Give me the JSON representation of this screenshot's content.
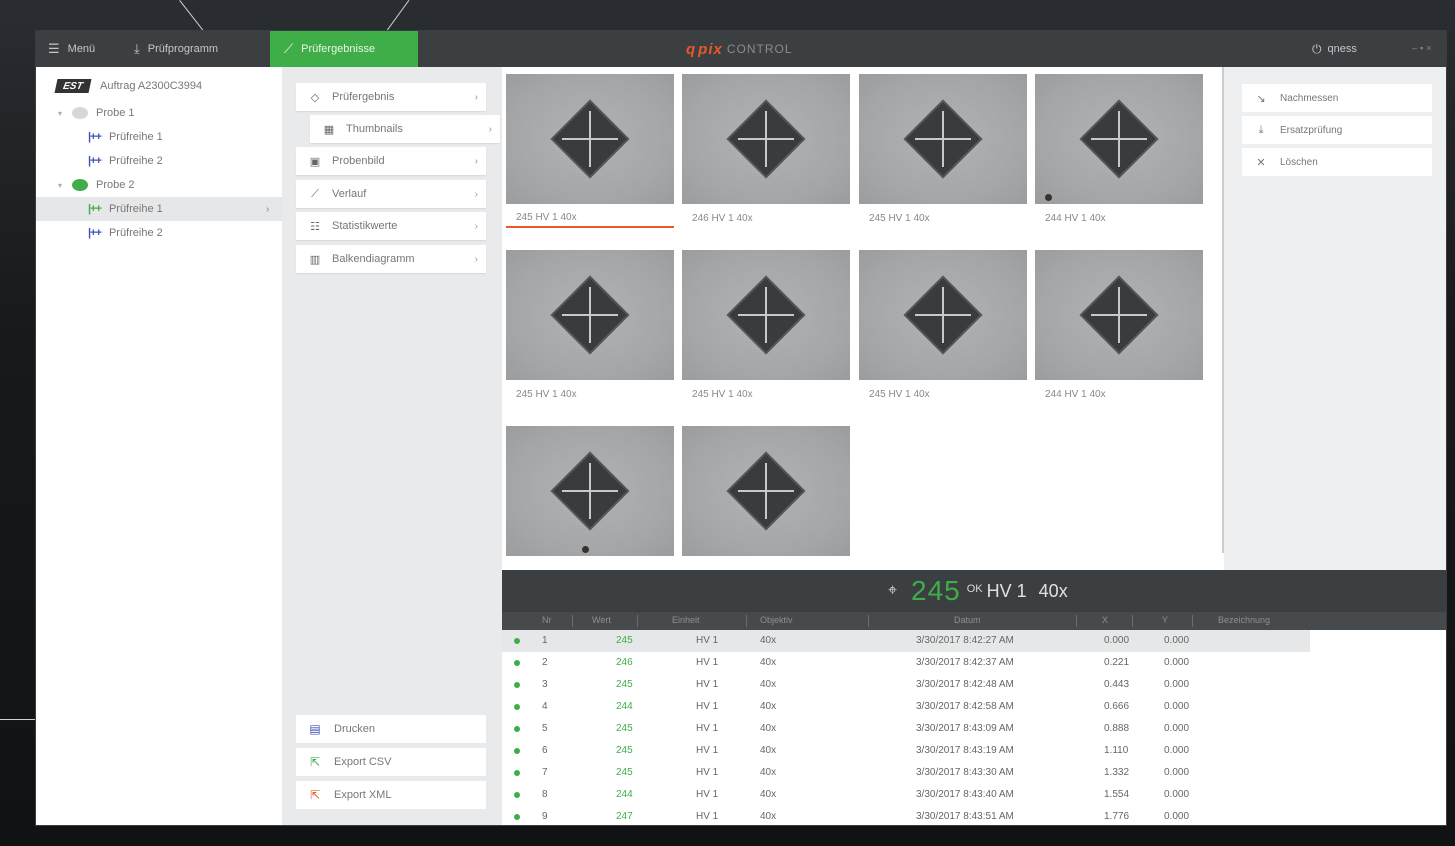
{
  "topbar": {
    "menu_label": "Menü",
    "pruefprogramm_label": "Prüfprogramm",
    "active_tab_label": "Prüfergebnisse",
    "brand_q": "q",
    "brand_pix": "pix",
    "brand_control": "CONTROL",
    "user_label": "qness"
  },
  "tree": {
    "order_label": "Auftrag A2300C3994",
    "items": [
      {
        "label": "Probe 1",
        "level": 0
      },
      {
        "label": "Prüfreihe 1",
        "level": 1
      },
      {
        "label": "Prüfreihe 2",
        "level": 1
      },
      {
        "label": "Probe 2",
        "level": 0
      },
      {
        "label": "Prüfreihe 1",
        "level": 1,
        "selected": true
      },
      {
        "label": "Prüfreihe 2",
        "level": 1
      }
    ]
  },
  "nav": {
    "items": [
      {
        "label": "Prüfergebnis"
      },
      {
        "label": "Thumbnails"
      },
      {
        "label": "Probenbild"
      },
      {
        "label": "Verlauf"
      },
      {
        "label": "Statistikwerte"
      },
      {
        "label": "Balkendiagramm"
      }
    ],
    "bottom": [
      {
        "label": "Drucken"
      },
      {
        "label": "Export CSV"
      },
      {
        "label": "Export XML"
      }
    ]
  },
  "thumbnails": {
    "items": [
      {
        "label": "245 HV 1  40x",
        "active": true
      },
      {
        "label": "246 HV 1  40x"
      },
      {
        "label": "245 HV 1  40x"
      },
      {
        "label": "244 HV 1  40x"
      },
      {
        "label": "245 HV 1  40x"
      },
      {
        "label": "245 HV 1  40x"
      },
      {
        "label": "245 HV 1  40x"
      },
      {
        "label": "244 HV 1  40x"
      },
      {
        "label": ""
      },
      {
        "label": ""
      }
    ]
  },
  "actions": {
    "items": [
      {
        "label": "Nachmessen"
      },
      {
        "label": "Ersatzprüfung"
      },
      {
        "label": "Löschen"
      }
    ]
  },
  "result": {
    "value": "245",
    "status": "OK",
    "method": "HV 1",
    "objective": "40x"
  },
  "table": {
    "headers": [
      "Nr",
      "Wert",
      "Einheit",
      "Objektiv",
      "Datum",
      "X",
      "Y",
      "Bezeichnung"
    ],
    "rows": [
      {
        "nr": "1",
        "wert": "245",
        "einheit": "HV 1",
        "objektiv": "40x",
        "datum": "3/30/2017 8:42:27 AM",
        "x": "0.000",
        "y": "0.000"
      },
      {
        "nr": "2",
        "wert": "246",
        "einheit": "HV 1",
        "objektiv": "40x",
        "datum": "3/30/2017 8:42:37 AM",
        "x": "0.221",
        "y": "0.000"
      },
      {
        "nr": "3",
        "wert": "245",
        "einheit": "HV 1",
        "objektiv": "40x",
        "datum": "3/30/2017 8:42:48 AM",
        "x": "0.443",
        "y": "0.000"
      },
      {
        "nr": "4",
        "wert": "244",
        "einheit": "HV 1",
        "objektiv": "40x",
        "datum": "3/30/2017 8:42:58 AM",
        "x": "0.666",
        "y": "0.000"
      },
      {
        "nr": "5",
        "wert": "245",
        "einheit": "HV 1",
        "objektiv": "40x",
        "datum": "3/30/2017 8:43:09 AM",
        "x": "0.888",
        "y": "0.000"
      },
      {
        "nr": "6",
        "wert": "245",
        "einheit": "HV 1",
        "objektiv": "40x",
        "datum": "3/30/2017 8:43:19 AM",
        "x": "1.110",
        "y": "0.000"
      },
      {
        "nr": "7",
        "wert": "245",
        "einheit": "HV 1",
        "objektiv": "40x",
        "datum": "3/30/2017 8:43:30 AM",
        "x": "1.332",
        "y": "0.000"
      },
      {
        "nr": "8",
        "wert": "244",
        "einheit": "HV 1",
        "objektiv": "40x",
        "datum": "3/30/2017 8:43:40 AM",
        "x": "1.554",
        "y": "0.000"
      },
      {
        "nr": "9",
        "wert": "247",
        "einheit": "HV 1",
        "objektiv": "40x",
        "datum": "3/30/2017 8:43:51 AM",
        "x": "1.776",
        "y": "0.000"
      }
    ]
  },
  "colors": {
    "accent_green": "#3fae49",
    "accent_orange": "#e8592a",
    "topbar": "#3c3f42"
  },
  "icons": {
    "menu": "hamburger-icon",
    "program": "download-icon",
    "results": "chart-icon",
    "user": "power-icon"
  }
}
